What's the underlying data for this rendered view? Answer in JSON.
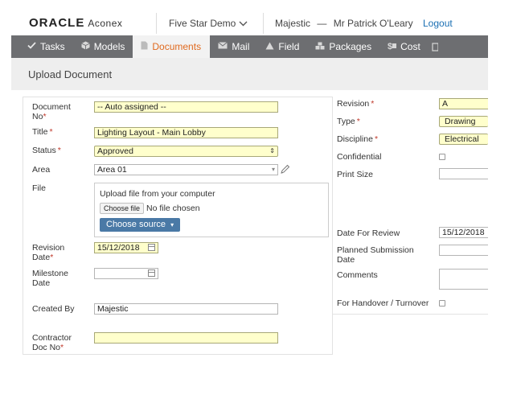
{
  "header": {
    "logo_oracle": "ORACLE",
    "logo_aconex": "Aconex",
    "project": "Five Star Demo",
    "org": "Majestic",
    "separator": "—",
    "user": "Mr Patrick O'Leary",
    "logout": "Logout"
  },
  "nav": {
    "items": [
      {
        "label": "Tasks",
        "icon": "check-icon"
      },
      {
        "label": "Models",
        "icon": "cube-icon"
      },
      {
        "label": "Documents",
        "icon": "document-icon",
        "active": true
      },
      {
        "label": "Mail",
        "icon": "mail-icon"
      },
      {
        "label": "Field",
        "icon": "field-icon"
      },
      {
        "label": "Packages",
        "icon": "packages-icon"
      },
      {
        "label": "Cost",
        "icon": "cost-icon"
      }
    ]
  },
  "page": {
    "title": "Upload Document"
  },
  "form": {
    "doc_no": {
      "label_1": "Document",
      "label_2": "No",
      "value": "-- Auto assigned --"
    },
    "title": {
      "label": "Title",
      "value": "Lighting Layout - Main Lobby"
    },
    "status": {
      "label": "Status",
      "value": "Approved"
    },
    "area": {
      "label": "Area",
      "value": "Area 01"
    },
    "file": {
      "label": "File",
      "upload_text": "Upload file from your computer",
      "choose_file": "Choose file",
      "no_file": "No file chosen",
      "choose_source": "Choose source"
    },
    "revision_date": {
      "label_1": "Revision",
      "label_2": "Date",
      "value": "15/12/2018"
    },
    "milestone_date": {
      "label_1": "Milestone",
      "label_2": "Date",
      "value": ""
    },
    "created_by": {
      "label": "Created By",
      "value": "Majestic"
    },
    "contractor_doc": {
      "label_1": "Contractor",
      "label_2": "Doc No",
      "value": ""
    }
  },
  "right": {
    "revision": {
      "label": "Revision",
      "value": "A"
    },
    "type": {
      "label": "Type",
      "value": "Drawing"
    },
    "discipline": {
      "label": "Discipline",
      "value": "Electrical"
    },
    "confidential": {
      "label": "Confidential",
      "checked": false
    },
    "print_size": {
      "label": "Print Size",
      "value": ""
    },
    "date_for_review": {
      "label": "Date For Review",
      "value": "15/12/2018"
    },
    "planned_submission": {
      "label_1": "Planned Submission",
      "label_2": "Date",
      "value": ""
    },
    "comments": {
      "label": "Comments",
      "value": ""
    },
    "handover": {
      "label": "For Handover / Turnover",
      "checked": false
    }
  },
  "symbols": {
    "required": "*",
    "dropdown_arrow": "⇕",
    "caret": "▾"
  },
  "colors": {
    "nav_bg": "#6d6e71",
    "active_tab_text": "#e06a1f",
    "required_field_bg": "#ffffcc",
    "primary_button": "#4a79a6",
    "logout_link": "#1a6fb3"
  }
}
